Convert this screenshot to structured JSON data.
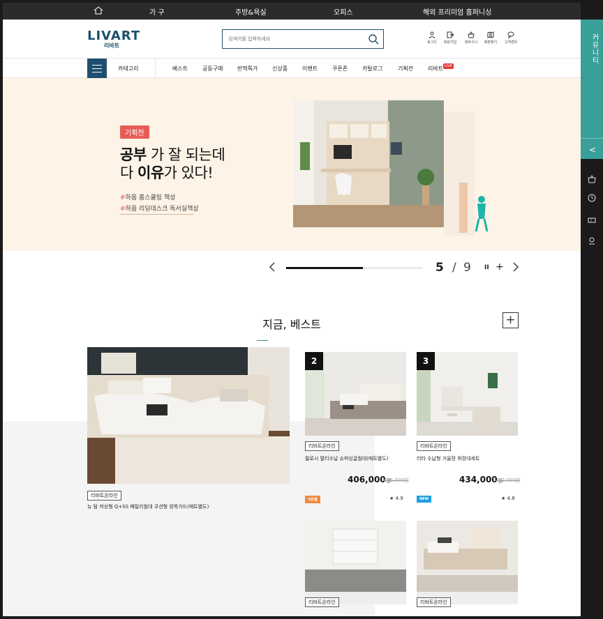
{
  "top_bar": {
    "items": [
      "가 구",
      "주방&욕실",
      "오피스",
      "해외 프리미엄 홈퍼니싱"
    ]
  },
  "header": {
    "logo_en": "LIVART",
    "logo_ko": "리바트",
    "search_placeholder": "검색어를 입력하세요",
    "utilities": [
      "로그인",
      "회원가입",
      "장바구니",
      "매장찾기",
      "고객센터"
    ]
  },
  "nav": {
    "category_label": "카테고리",
    "items": [
      "베스트",
      "공동구매",
      "반짝특가",
      "신상품",
      "이벤트",
      "쿠폰존",
      "카탈로그",
      "기획전",
      "리바트"
    ],
    "live_badge": "LIVE"
  },
  "banner": {
    "badge": "기획전",
    "headline_line1_bold": "공부",
    "headline_line1_rest": " 가 잘 되는데",
    "headline_line2_a": "다 ",
    "headline_line2_bold": "이유",
    "headline_line2_rest": "가 있다!",
    "tags": [
      "하움 홈스쿨링 책상",
      "하움 리딩데스크 독서실책상"
    ]
  },
  "pager": {
    "current": "5",
    "separator": "/",
    "total": "9",
    "progress": 0.56,
    "pause": "II",
    "plus": "+"
  },
  "best_section": {
    "title": "지금, 베스트",
    "featured": {
      "chip": "리바트온라인",
      "name": "뉴 탐 저상형 Q+SS 패밀리침대 쿠션형 양목가드(매트별도)"
    },
    "products": [
      {
        "rank": "2",
        "chip": "리바트온라인",
        "name": "필로시 멀티수납 슈퍼싱글침대(매트별도)",
        "price": "406,000",
        "won": "원",
        "old_price": "635,000원",
        "status": "사은품",
        "status_color": "#f08a3c",
        "rating": "4.9"
      },
      {
        "rank": "3",
        "chip": "리바트온라인",
        "name": "리타 수납형 거울장 화장대세트",
        "price": "434,000",
        "won": "원",
        "old_price": "712,000원",
        "status": "NEW",
        "status_color": "#1e9ee0",
        "rating": "4.8"
      },
      {
        "chip": "리바트온라인"
      },
      {
        "chip": "리바트온라인"
      }
    ]
  },
  "sidebar": {
    "tab_label": "커뮤니티",
    "chevron": "<"
  },
  "colors": {
    "brand": "#1f4f6e",
    "banner_bg": "#fdf3e6",
    "accent_red": "#e85c55",
    "sidebar_teal": "#3a9e99"
  }
}
